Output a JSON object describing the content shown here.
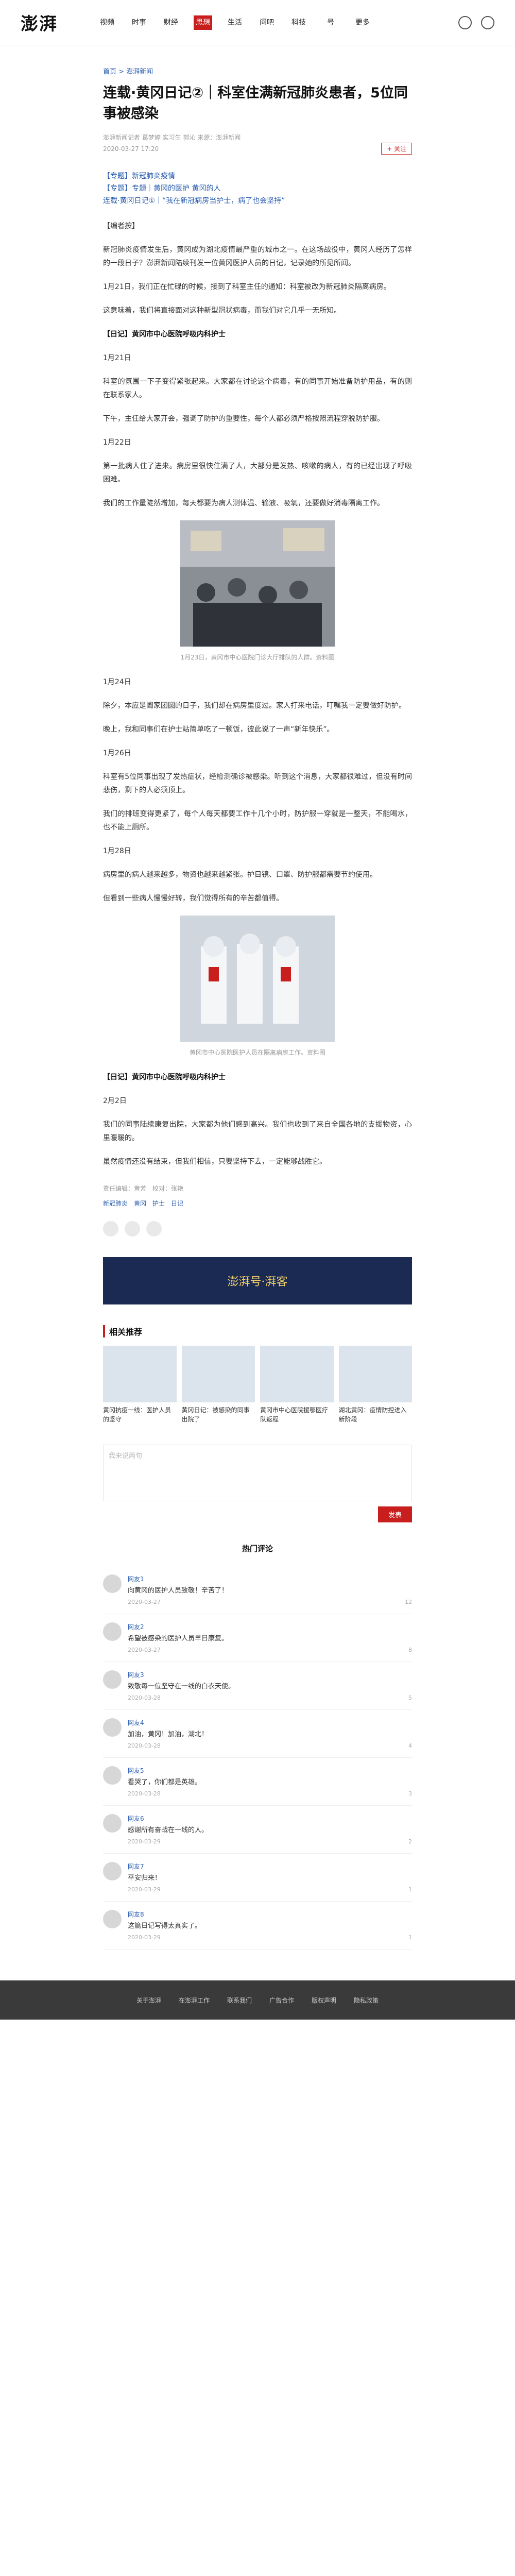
{
  "header": {
    "logo": "澎湃",
    "nav": [
      "视频",
      "时事",
      "财经",
      "思想",
      "生活",
      "问吧",
      "科技",
      "号",
      "更多"
    ],
    "active_nav": 3
  },
  "breadcrumb": "首页 > 澎湃新闻",
  "title": "连载·黄冈日记②｜科室住满新冠肺炎患者，5位同事被感染",
  "meta": {
    "line1": "澎湃新闻记者 葛梦婷 实习生 郭沁 来源：澎湃新闻",
    "line2": "2020-03-27 17:20",
    "follow": "+ 关注"
  },
  "related_links": [
    "【专题】新冠肺炎疫情",
    "【专题】专题｜黄冈的医护 黄冈的人",
    "连载·黄冈日记①｜“我在新冠病房当护士，病了也会坚持”"
  ],
  "paragraphs": [
    "【编者按】",
    "新冠肺炎疫情发生后，黄冈成为湖北疫情最严重的城市之一。在这场战役中，黄冈人经历了怎样的一段日子？澎湃新闻陆续刊发一位黄冈医护人员的日记，记录她的所见所闻。",
    "1月21日，我们正在忙碌的时候，接到了科室主任的通知：科室被改为新冠肺炎隔离病房。",
    "这意味着，我们将直接面对这种新型冠状病毒，而我们对它几乎一无所知。"
  ],
  "section1_title": "【日记】黄冈市中心医院呼吸内科护士",
  "section1_paragraphs": [
    "1月21日",
    "科室的氛围一下子变得紧张起来。大家都在讨论这个病毒，有的同事开始准备防护用品，有的则在联系家人。",
    "下午，主任给大家开会，强调了防护的重要性，每个人都必须严格按照流程穿脱防护服。",
    "1月22日",
    "第一批病人住了进来。病房里很快住满了人，大部分是发热、咳嗽的病人，有的已经出现了呼吸困难。",
    "我们的工作量陡然增加，每天都要为病人测体温、输液、吸氧，还要做好消毒隔离工作。"
  ],
  "image1_caption": "1月23日，黄冈市中心医院门诊大厅排队的人群。资料图",
  "section2_paragraphs": [
    "1月24日",
    "除夕，本应是阖家团圆的日子，我们却在病房里度过。家人打来电话，叮嘱我一定要做好防护。",
    "晚上，我和同事们在护士站简单吃了一顿饭，彼此说了一声“新年快乐”。",
    "1月26日",
    "科室有5位同事出现了发热症状，经检测确诊被感染。听到这个消息，大家都很难过，但没有时间悲伤，剩下的人必须顶上。",
    "我们的排班变得更紧了，每个人每天都要工作十几个小时，防护服一穿就是一整天，不能喝水，也不能上厕所。",
    "1月28日",
    "病房里的病人越来越多，物资也越来越紧张。护目镜、口罩、防护服都需要节约使用。",
    "但看到一些病人慢慢好转，我们觉得所有的辛苦都值得。"
  ],
  "image2_caption": "黄冈市中心医院医护人员在隔离病房工作。资料图",
  "section3_title": "【日记】黄冈市中心医院呼吸内科护士",
  "section3_paragraphs": [
    "2月2日",
    "我们的同事陆续康复出院，大家都为他们感到高兴。我们也收到了来自全国各地的支援物资，心里暖暖的。",
    "虽然疫情还没有结束，但我们相信，只要坚持下去，一定能够战胜它。"
  ],
  "footer_meta": {
    "editor": "责任编辑：黄芳　校对：张艳",
    "tags": "新冠肺炎　黄冈　护士　日记"
  },
  "banner_text": "澎湃号·湃客",
  "related_title": "相关推荐",
  "related_items": [
    "黄冈抗疫一线：医护人员的坚守",
    "黄冈日记：被感染的同事出院了",
    "黄冈市中心医院援鄂医疗队返程",
    "湖北黄冈：疫情防控进入新阶段"
  ],
  "comment": {
    "placeholder": "我来说两句",
    "submit": "发表",
    "heading": "热门评论"
  },
  "comments": [
    {
      "user": "网友1",
      "text": "向黄冈的医护人员致敬！辛苦了！",
      "time": "2020-03-27",
      "likes": "12"
    },
    {
      "user": "网友2",
      "text": "希望被感染的医护人员早日康复。",
      "time": "2020-03-27",
      "likes": "8"
    },
    {
      "user": "网友3",
      "text": "致敬每一位坚守在一线的白衣天使。",
      "time": "2020-03-28",
      "likes": "5"
    },
    {
      "user": "网友4",
      "text": "加油，黄冈！加油，湖北！",
      "time": "2020-03-28",
      "likes": "4"
    },
    {
      "user": "网友5",
      "text": "看哭了，你们都是英雄。",
      "time": "2020-03-28",
      "likes": "3"
    },
    {
      "user": "网友6",
      "text": "感谢所有奋战在一线的人。",
      "time": "2020-03-29",
      "likes": "2"
    },
    {
      "user": "网友7",
      "text": "平安归来！",
      "time": "2020-03-29",
      "likes": "1"
    },
    {
      "user": "网友8",
      "text": "这篇日记写得太真实了。",
      "time": "2020-03-29",
      "likes": "1"
    }
  ],
  "footer_links": [
    "关于澎湃",
    "在澎湃工作",
    "联系我们",
    "广告合作",
    "版权声明",
    "隐私政策"
  ]
}
